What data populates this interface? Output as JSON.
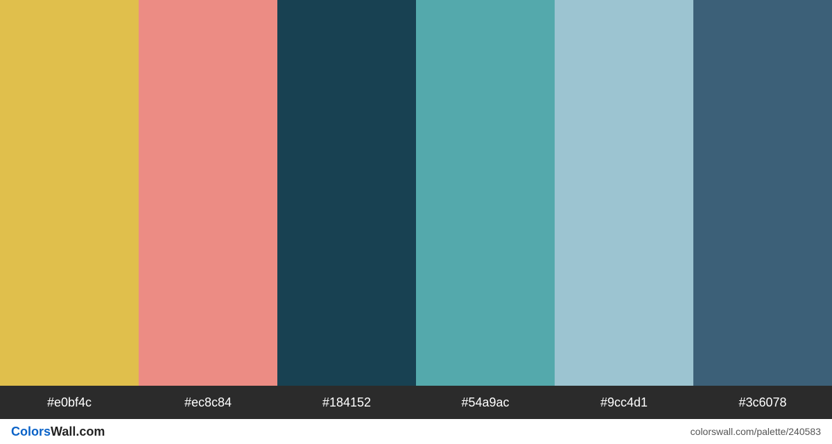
{
  "colors": [
    {
      "hex": "#e0bf4c"
    },
    {
      "hex": "#ec8c84"
    },
    {
      "hex": "#184152"
    },
    {
      "hex": "#54a9ac"
    },
    {
      "hex": "#9cc4d1"
    },
    {
      "hex": "#3c6078"
    }
  ],
  "brand": {
    "part1": "Colors",
    "part2": "Wall.com"
  },
  "footer_url": "colorswall.com/palette/240583"
}
